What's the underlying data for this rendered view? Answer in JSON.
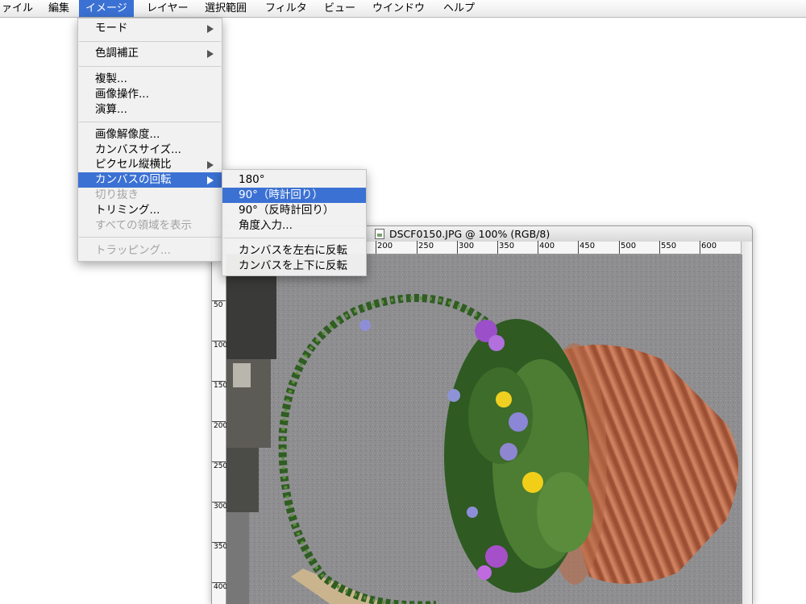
{
  "menubar": {
    "items": [
      "ァイル",
      "編集",
      "イメージ",
      "レイヤー",
      "選択範囲",
      "フィルタ",
      "ビュー",
      "ウインドウ",
      "ヘルプ"
    ],
    "active_index": 2
  },
  "image_menu": {
    "items": [
      {
        "label": "モード",
        "submenu": true,
        "enabled": true
      },
      {
        "label": "色調補正",
        "submenu": true,
        "enabled": true
      },
      {
        "label": "複製...",
        "enabled": true
      },
      {
        "label": "画像操作...",
        "enabled": true
      },
      {
        "label": "演算...",
        "enabled": true
      },
      {
        "label": "画像解像度...",
        "enabled": true
      },
      {
        "label": "カンバスサイズ...",
        "enabled": true
      },
      {
        "label": "ピクセル縦横比",
        "submenu": true,
        "enabled": true
      },
      {
        "label": "カンバスの回転",
        "submenu": true,
        "enabled": true,
        "highlighted": true
      },
      {
        "label": "切り抜き",
        "enabled": false
      },
      {
        "label": "トリミング...",
        "enabled": true
      },
      {
        "label": "すべての領域を表示",
        "enabled": false
      },
      {
        "label": "トラッピング...",
        "enabled": false
      }
    ]
  },
  "rotate_submenu": {
    "items": [
      {
        "label": "180°"
      },
      {
        "label": "90°（時計回り）",
        "highlighted": true
      },
      {
        "label": "90°（反時計回り）"
      },
      {
        "label": "角度入力..."
      },
      {
        "label": "カンバスを左右に反転"
      },
      {
        "label": "カンバスを上下に反転"
      }
    ]
  },
  "document": {
    "title": "DSCF0150.JPG @ 100% (RGB/8)",
    "hruler_labels": [
      "200",
      "250",
      "300",
      "350",
      "400",
      "450",
      "500",
      "550",
      "600"
    ],
    "vruler_labels": [
      "50",
      "100",
      "150",
      "200",
      "250",
      "300",
      "350",
      "400"
    ]
  },
  "colors": {
    "highlight": "#3b71d3",
    "disabled_text": "#a3a3a3"
  }
}
